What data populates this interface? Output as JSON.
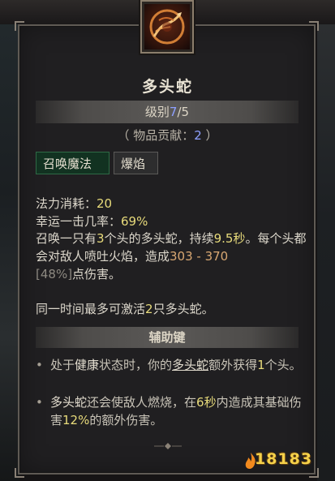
{
  "skill": {
    "title": "多头蛇",
    "rank_label": "级别",
    "rank_current": "7",
    "rank_max": "/5",
    "contrib_prefix": "（ 物品贡献：",
    "contrib_value": "2",
    "contrib_suffix": " ）"
  },
  "tags": [
    {
      "label": "召唤魔法"
    },
    {
      "label": "爆焰"
    }
  ],
  "stats": {
    "mana_label": "法力消耗：",
    "mana_value": "20",
    "luck_label": "幸运一击几率：",
    "luck_value": "69%"
  },
  "description": {
    "p1_a": "召唤一只有",
    "p1_heads": "3",
    "p1_b": "个头的多头蛇，持续",
    "p1_duration": "9.5秒",
    "p1_c": "。每个头都会对敌人喷吐火焰，造成",
    "p1_damage": "303 - 370",
    "p1_d": " ",
    "p1_pct": "[48%]",
    "p1_e": "点伤害。",
    "p2_a": "同一时间最多可激活",
    "p2_count": "2",
    "p2_b": "只多头蛇。"
  },
  "aux": {
    "header": "辅助键",
    "b1_a": "处于",
    "b1_healthy": "健康",
    "b1_b": "状态时，你的",
    "b1_hydra": "多头蛇",
    "b1_c": "额外获得",
    "b1_heads": "1",
    "b1_d": "个头。",
    "b2_hydra": "多头蛇",
    "b2_a": "还会使敌人燃烧，在",
    "b2_secs": "6秒",
    "b2_b": "内造成其基础伤害",
    "b2_pct": "12%",
    "b2_c": "的额外伤害。"
  },
  "watermark": "18183",
  "icons": {
    "skill_icon": "hydra-skill-icon",
    "bullet_icon": "diamond-bullet-icon",
    "divider_icon": "ornament-divider-icon"
  },
  "colors": {
    "rank_accent": "#8ea0ff",
    "value_yellow": "#e8db7b",
    "damage_orange": "#d8a772",
    "summon_tag_bg": "#123221"
  }
}
